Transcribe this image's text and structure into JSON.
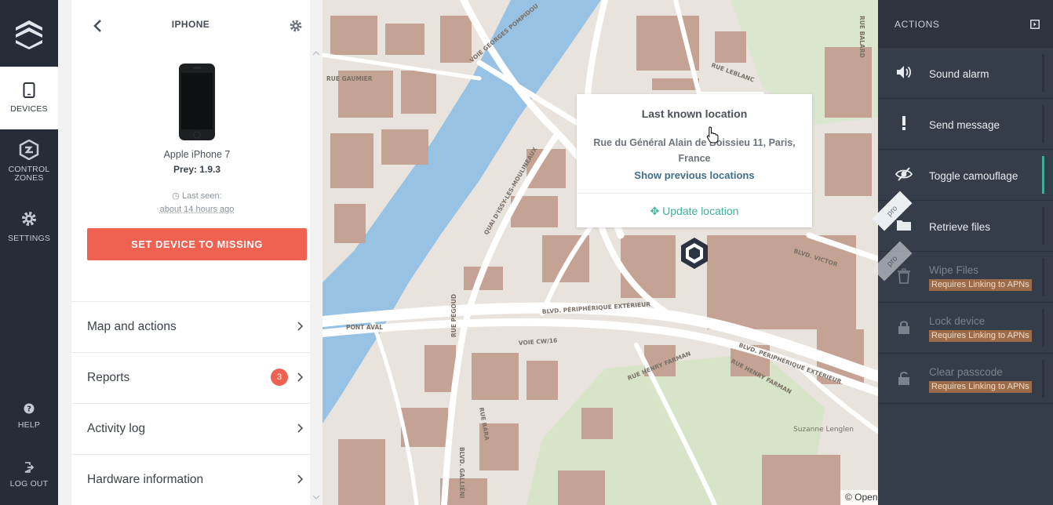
{
  "nav": {
    "items": [
      {
        "label": "DEVICES",
        "icon": "tablet-icon"
      },
      {
        "label": "CONTROL\nZONES",
        "icon": "control-zones-icon"
      },
      {
        "label": "SETTINGS",
        "icon": "gear-icon"
      }
    ],
    "help": "HELP",
    "logout": "LOG OUT"
  },
  "device": {
    "header_title": "IPHONE",
    "name": "Apple iPhone 7",
    "prey_version": "Prey: 1.9.3",
    "last_seen_label": "Last seen:",
    "last_seen_time": "about 14 hours ago",
    "missing_button": "SET DEVICE TO MISSING",
    "menu": [
      {
        "label": "Map and actions"
      },
      {
        "label": "Reports",
        "badge": "3"
      },
      {
        "label": "Activity log"
      },
      {
        "label": "Hardware information"
      }
    ]
  },
  "map": {
    "popup": {
      "title": "Last known location",
      "address": "Rue du Général Alain de Boissieu 11, Paris, France",
      "show_previous": "Show previous locations",
      "update": "Update location"
    },
    "attribution": "© Open"
  },
  "actions": {
    "title": "ACTIONS",
    "items": [
      {
        "label": "Sound alarm",
        "icon": "speaker-icon",
        "enabled": true
      },
      {
        "label": "Send message",
        "icon": "exclamation-icon",
        "enabled": true
      },
      {
        "label": "Toggle camouflage",
        "icon": "eye-slash-icon",
        "enabled": true,
        "active": true
      },
      {
        "label": "Retrieve files",
        "icon": "folder-icon",
        "enabled": true,
        "tag": "pro"
      },
      {
        "label": "Wipe Files",
        "icon": "trash-icon",
        "enabled": false,
        "tag": "pro",
        "note": "Requires Linking to APNs"
      },
      {
        "label": "Lock device",
        "icon": "lock-icon",
        "enabled": false,
        "note": "Requires Linking to APNs"
      },
      {
        "label": "Clear passcode",
        "icon": "unlock-icon",
        "enabled": false,
        "note": "Requires Linking to APNs"
      }
    ]
  },
  "colors": {
    "accent_red": "#ef6150",
    "accent_teal": "#3fae9b",
    "link_blue": "#3f6e8c",
    "sidebar_dark": "#262d38"
  }
}
